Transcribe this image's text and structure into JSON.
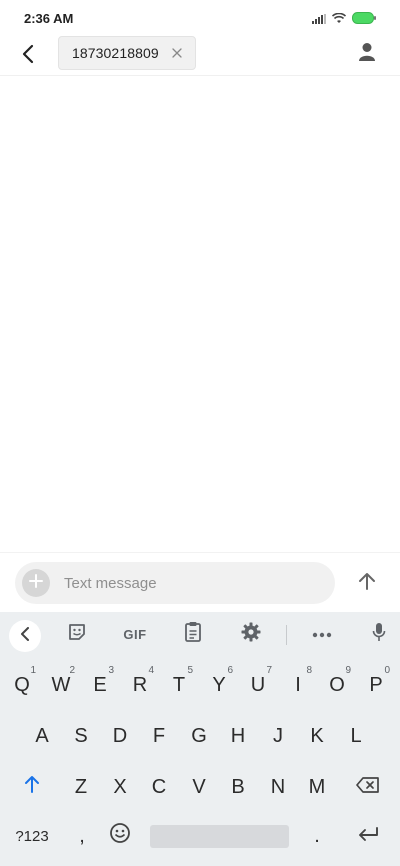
{
  "status_bar": {
    "time": "2:36 AM",
    "icons": [
      "signal-icon",
      "wifi-icon",
      "battery-icon"
    ],
    "battery_color": "#4cd964"
  },
  "header": {
    "back_icon": "back-arrow-icon",
    "recipient": "18730218809",
    "chip_remove_icon": "close-icon",
    "contact_icon": "person-icon"
  },
  "compose": {
    "placeholder": "Text message",
    "attach_icon": "plus-icon",
    "send_icon": "arrow-up-icon"
  },
  "keyboard": {
    "toolbar": {
      "back_icon": "chevron-left-icon",
      "sticker_icon": "sticker-icon",
      "gif_label": "GIF",
      "clipboard_icon": "clipboard-icon",
      "settings_icon": "gear-icon",
      "more_icon": "more-icon",
      "mic_icon": "mic-icon"
    },
    "row1": [
      {
        "label": "Q",
        "hint": "1"
      },
      {
        "label": "W",
        "hint": "2"
      },
      {
        "label": "E",
        "hint": "3"
      },
      {
        "label": "R",
        "hint": "4"
      },
      {
        "label": "T",
        "hint": "5"
      },
      {
        "label": "Y",
        "hint": "6"
      },
      {
        "label": "U",
        "hint": "7"
      },
      {
        "label": "I",
        "hint": "8"
      },
      {
        "label": "O",
        "hint": "9"
      },
      {
        "label": "P",
        "hint": "0"
      }
    ],
    "row2": [
      "A",
      "S",
      "D",
      "F",
      "G",
      "H",
      "J",
      "K",
      "L"
    ],
    "row3": [
      "Z",
      "X",
      "C",
      "V",
      "B",
      "N",
      "M"
    ],
    "symbols_label": "?123",
    "comma_label": ",",
    "period_label": ".",
    "shift_color": "#1a73e8"
  }
}
